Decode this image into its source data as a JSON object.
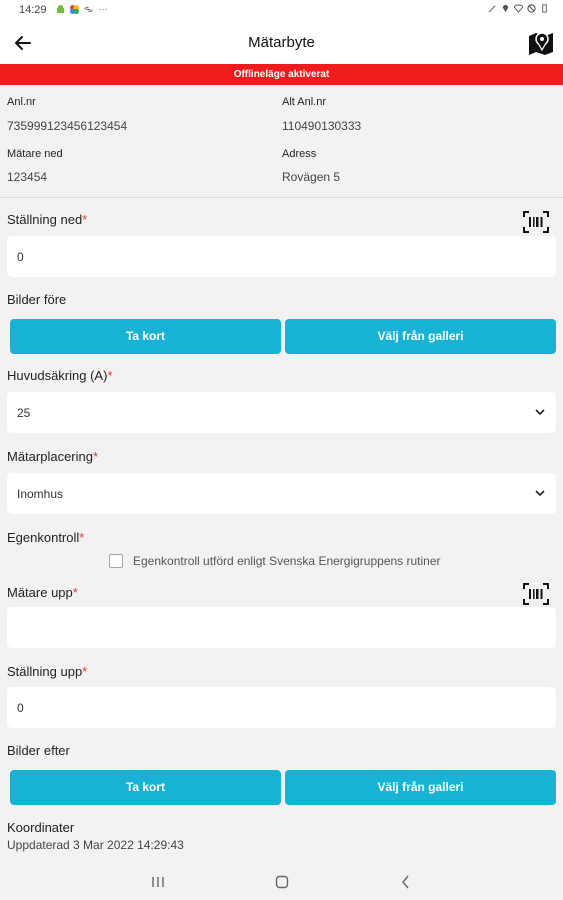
{
  "status_bar": {
    "time": "14:29",
    "left_icons": [
      "android-icon",
      "photos-icon",
      "link-icon",
      "more-dots-icon"
    ],
    "right_icons": [
      "edit-icon",
      "location-icon",
      "wifi-icon",
      "dnd-icon",
      "battery-icon"
    ]
  },
  "appbar": {
    "title": "Mätarbyte"
  },
  "offline_banner": {
    "text": "Offlineläge aktiverat",
    "color": "#ee1c1c"
  },
  "info": {
    "anl_nr_label": "Anl.nr",
    "anl_nr_value": "735999123456123454",
    "alt_anl_nr_label": "Alt Anl.nr",
    "alt_anl_nr_value": "110490130333",
    "matare_ned_label": "Mätare ned",
    "matare_ned_value": "123454",
    "adress_label": "Adress",
    "adress_value": "Rovägen 5"
  },
  "form": {
    "stallning_ned": {
      "label": "Ställning ned",
      "required": "*",
      "value": "0"
    },
    "bilder_fore": {
      "label": "Bilder före",
      "take_photo": "Ta kort",
      "gallery": "Välj från galleri"
    },
    "huvudsakring": {
      "label": "Huvudsäkring (A)",
      "required": "*",
      "value": "25"
    },
    "matarplacering": {
      "label": "Mätarplacering",
      "required": "*",
      "value": "Inomhus"
    },
    "egenkontroll": {
      "label": "Egenkontroll",
      "required": "*",
      "checkbox_label": "Egenkontroll utförd enligt Svenska Energigruppens rutiner",
      "checked": false
    },
    "matare_upp": {
      "label": "Mätare upp",
      "required": "*",
      "value": ""
    },
    "stallning_upp": {
      "label": "Ställning upp",
      "required": "*",
      "value": "0"
    },
    "bilder_efter": {
      "label": "Bilder efter",
      "take_photo": "Ta kort",
      "gallery": "Välj från galleri"
    },
    "koordinater": {
      "label": "Koordinater",
      "value": "Uppdaterad 3 Mar 2022 14:29:43"
    }
  },
  "colors": {
    "accent": "#18b3d4",
    "required": "#e53935",
    "background": "#f2f2f2"
  },
  "navbar": {
    "icons": [
      "recents-icon",
      "home-icon",
      "back-nav-icon"
    ]
  }
}
